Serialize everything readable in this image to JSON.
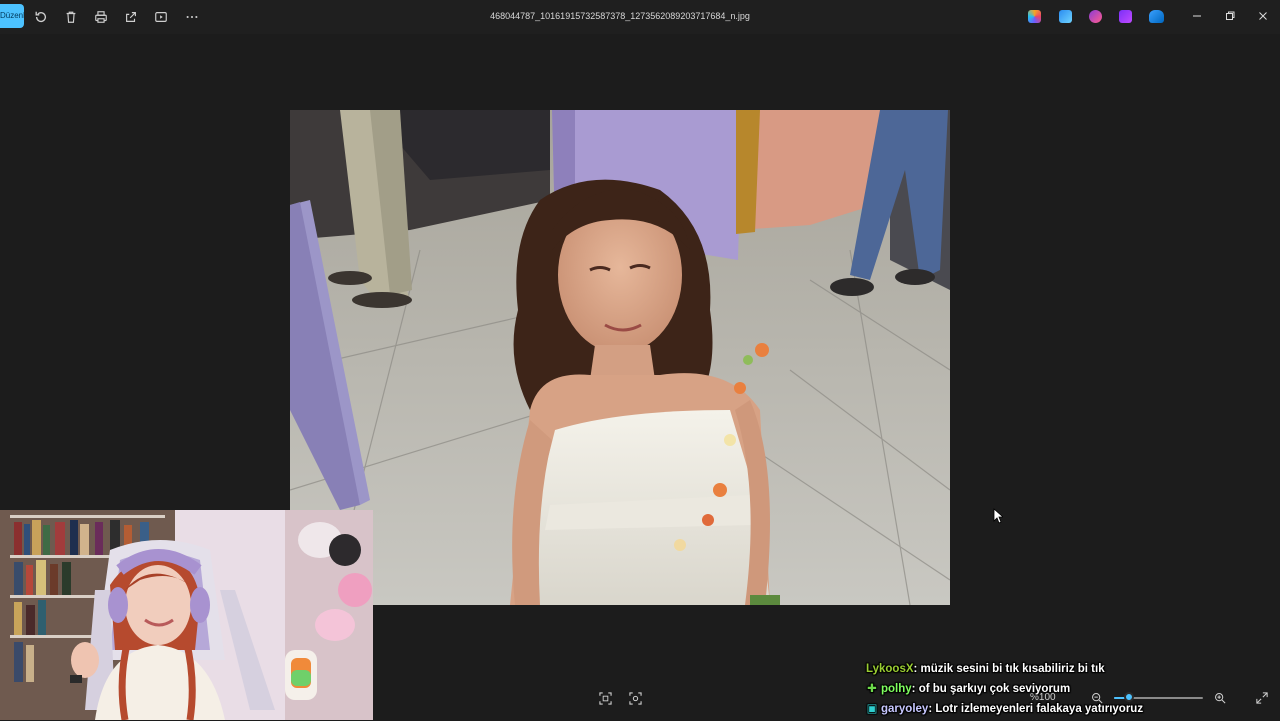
{
  "toolbar": {
    "edit_label": "Düzenle",
    "icons": [
      "rotate-icon",
      "delete-icon",
      "print-icon",
      "share-icon",
      "slideshow-icon",
      "more-icon"
    ]
  },
  "window": {
    "filename": "468044787_10161915732587378_1273562089203717684_n.jpg",
    "app_icons": [
      "copilot-icon",
      "editor-icon",
      "clipchamp-icon",
      "designer-icon",
      "onedrive-icon"
    ],
    "controls": [
      "minimize-icon",
      "restore-icon",
      "close-icon"
    ]
  },
  "bottom_bar": {
    "zoom_label": "%100",
    "zoom_level_fraction": 0.17,
    "icons": [
      "fit-to-window-icon",
      "visual-search-icon",
      "zoom-out-icon",
      "zoom-in-icon",
      "fullscreen-icon"
    ]
  },
  "chat": [
    {
      "user": "LykoosX",
      "user_color": "#9acd32",
      "badge": "",
      "message": ": müzik sesini bi tık kısabiliriz bi tık"
    },
    {
      "user": "polhy",
      "user_color": "#7fff5f",
      "badge": "✚",
      "badge_color": "#6cd84a",
      "message": ": of bu şarkıyı çok seviyorum"
    },
    {
      "user": "garyoley",
      "user_color": "#c7c7ff",
      "badge": "▣",
      "badge_color": "#2fd0d0",
      "message": ": Lotr izlemeyenleri falakaya yatırıyoruz"
    }
  ]
}
